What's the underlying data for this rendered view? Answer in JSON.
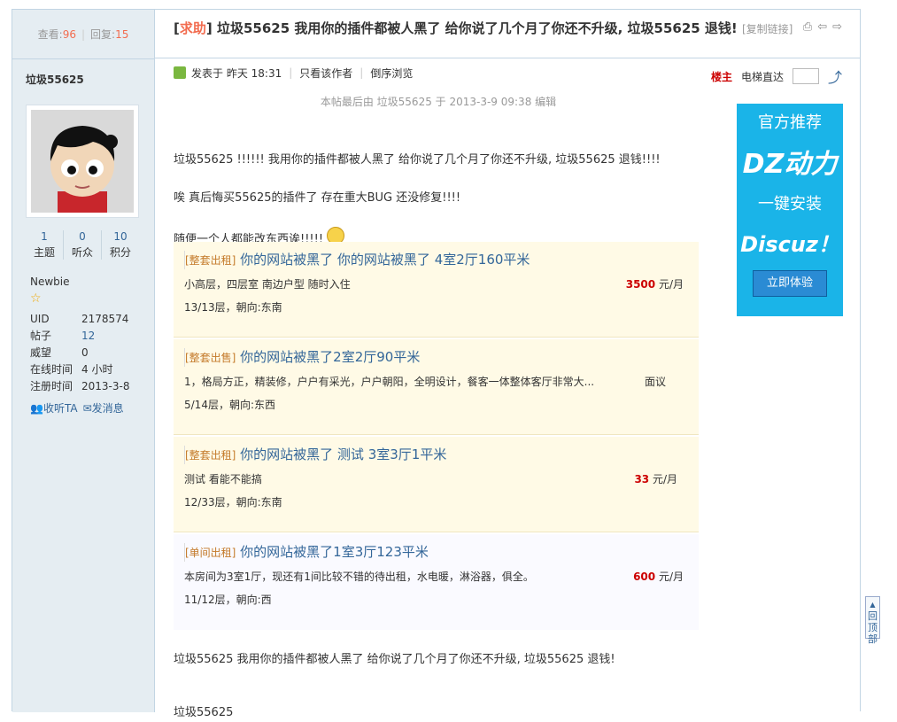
{
  "thread": {
    "views_label": "查看:",
    "views": "96",
    "replies_label": "回复:",
    "replies": "15",
    "tag": "求助",
    "title": "垃圾55625 我用你的插件都被人黑了 给你说了几个月了你还不升级, 垃圾55625 退钱!",
    "copy_link": "[复制链接]"
  },
  "author": {
    "name": "垃圾55625",
    "stats": [
      {
        "value": "1",
        "label": "主题"
      },
      {
        "value": "0",
        "label": "听众"
      },
      {
        "value": "10",
        "label": "积分"
      }
    ],
    "rank": "Newbie",
    "info": [
      {
        "key": "UID",
        "value": "2178574"
      },
      {
        "key": "帖子",
        "value": "12"
      },
      {
        "key": "威望",
        "value": "0"
      },
      {
        "key": "在线时间",
        "value": "4 小时"
      },
      {
        "key": "注册时间",
        "value": "2013-3-8"
      }
    ],
    "follow": "收听TA",
    "message": "发消息"
  },
  "postbar": {
    "posted": "发表于 昨天 18:31",
    "only_author": "只看该作者",
    "reverse": "倒序浏览",
    "floor": "楼主",
    "jump": "电梯直达"
  },
  "post": {
    "edit_note": "本帖最后由 垃圾55625 于 2013-3-9 09:38 编辑",
    "p1": "垃圾55625 !!!!!!   我用你的插件都被人黑了 给你说了几个月了你还不升级, 垃圾55625 退钱!!!!",
    "p2": "唉 真后悔买55625的插件了 存在重大BUG 还没修复!!!!",
    "p3": "随便一个人都能改东西诶!!!!!",
    "p4": "垃圾55625 我用你的插件都被人黑了 给你说了几个月了你还不升级, 垃圾55625 退钱!",
    "p5": "垃圾55625"
  },
  "listings": [
    {
      "tag": "[整套出租]",
      "title": "你的网站被黑了 你的网站被黑了 4室2厅160平米",
      "desc": "小高层，四层室 南边户型 随时入住",
      "price": "3500",
      "unit": " 元/月",
      "floor": "13/13层，朝向:东南"
    },
    {
      "tag": "[整套出售]",
      "title": "你的网站被黑了2室2厅90平米",
      "desc": "1，格局方正，精装修，户户有采光，户户朝阳，全明设计，餐客一体整体客厅非常大...",
      "price": "",
      "unit": "面议",
      "floor": "5/14层，朝向:东西"
    },
    {
      "tag": "[整套出租]",
      "title": "你的网站被黑了 测试 3室3厅1平米",
      "desc": "测试 看能不能搞",
      "price": "33",
      "unit": " 元/月",
      "floor": "12/33层，朝向:东南"
    },
    {
      "tag": "[单间出租]",
      "title": "你的网站被黑了1室3厅123平米",
      "desc": "本房间为3室1厅，现还有1间比较不错的待出租，水电暖，淋浴器，俱全。",
      "price": "600",
      "unit": " 元/月",
      "floor": "11/12层，朝向:西"
    }
  ],
  "ad": {
    "line1": "官方推荐",
    "line2": "DZ动力",
    "line3": "一键安装",
    "line4": "Discuz！",
    "button": "立即体验"
  },
  "back_top": "回顶部"
}
